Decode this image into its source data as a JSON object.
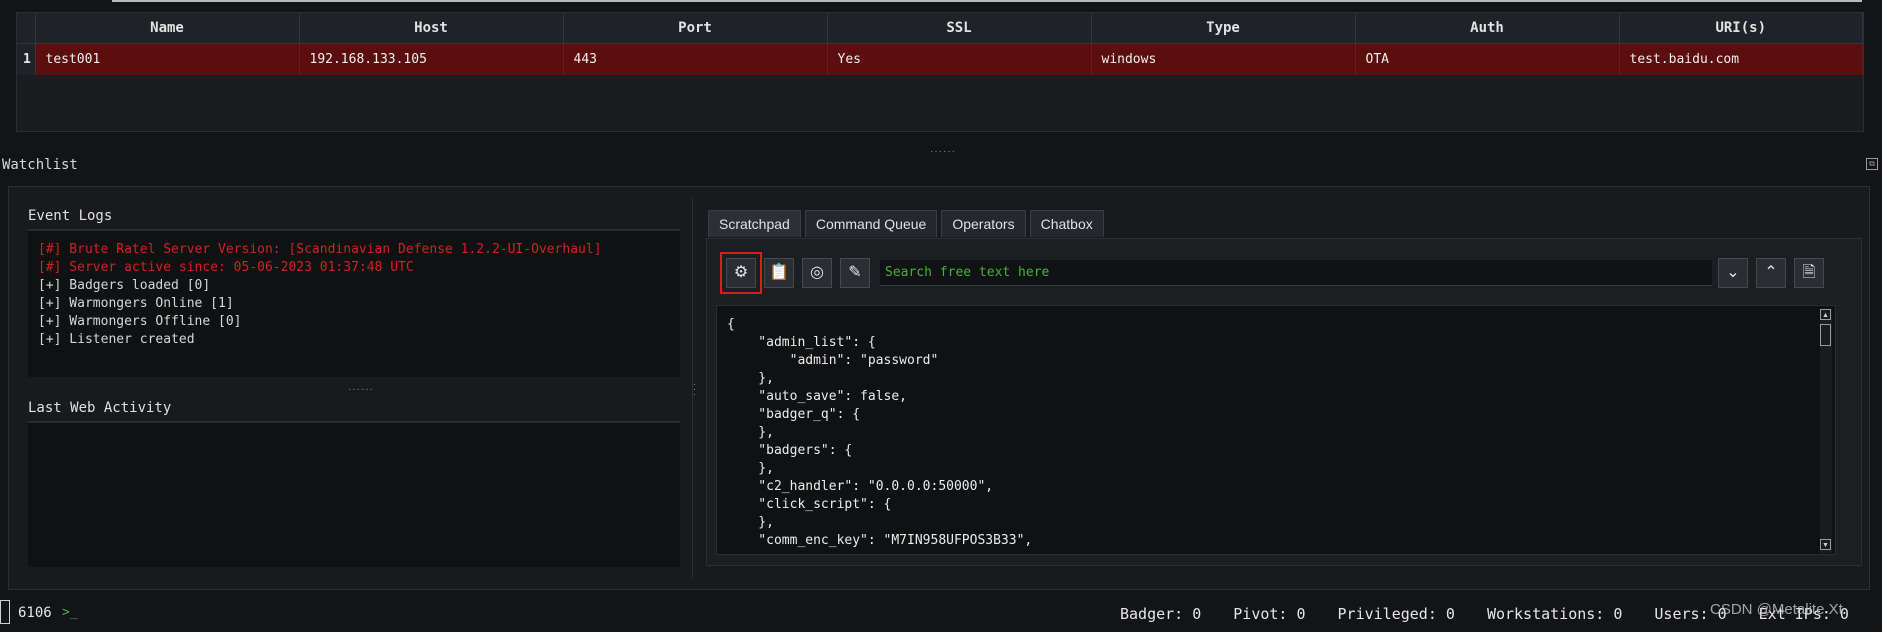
{
  "listeners": {
    "columns": [
      "Name",
      "Host",
      "Port",
      "SSL",
      "Type",
      "Auth",
      "URI(s)"
    ],
    "rows": [
      {
        "num": "1",
        "name": "test001",
        "host": "192.168.133.105",
        "port": "443",
        "ssl": "Yes",
        "type": "windows",
        "auth": "OTA",
        "uris": "test.baidu.com"
      }
    ]
  },
  "watchlist": {
    "title": "Watchlist"
  },
  "event_logs": {
    "title": "Event Logs",
    "lines": [
      "[#] Brute Ratel Server Version: [Scandinavian Defense 1.2.2-UI-Overhaul]",
      "[#] Server active since: 05-06-2023 01:37:48 UTC",
      "[+] Badgers loaded [0]",
      "[+] Warmongers Online [1]",
      "[+] Warmongers Offline [0]",
      "[+] Listener created"
    ]
  },
  "web_activity": {
    "title": "Last Web Activity"
  },
  "tabs": [
    "Scratchpad",
    "Command Queue",
    "Operators",
    "Chatbox"
  ],
  "scratchpad": {
    "search_placeholder": "Search free text here",
    "code": [
      "{",
      "    \"admin_list\": {",
      "        \"admin\": \"password\"",
      "    },",
      "    \"auto_save\": false,",
      "    \"badger_q\": {",
      "    },",
      "    \"badgers\": {",
      "    },",
      "    \"c2_handler\": \"0.0.0.0:50000\",",
      "    \"click_script\": {",
      "    },",
      "    \"comm_enc_key\": \"M7IN958UFPOS3B33\","
    ]
  },
  "status": {
    "port": "6106",
    "prompt": ">_",
    "badger": "Badger: 0",
    "pivot": "Pivot: 0",
    "privileged": "Privileged: 0",
    "workstations": "Workstations: 0",
    "users": "Users: 0",
    "ext_ips": "Ext IPs: 0",
    "watermark": "CSDN @Metalite Xt"
  },
  "colors": {
    "selected_row": "#5c0d0d",
    "log_red": "#d42020",
    "prompt_green": "#46b13c",
    "highlight": "#d81e1e"
  }
}
